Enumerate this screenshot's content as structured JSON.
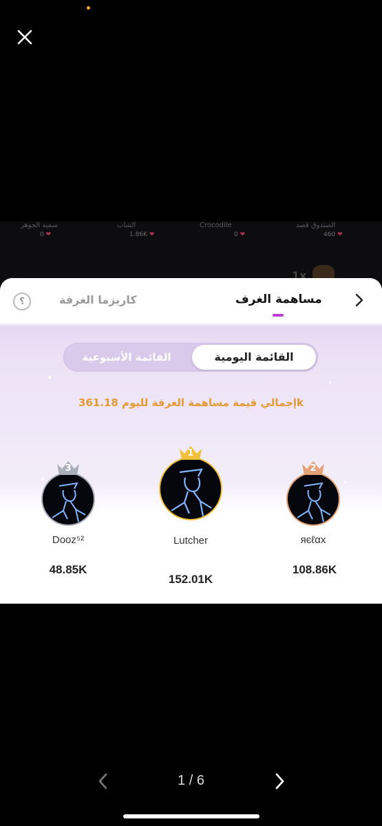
{
  "viewer": {
    "pager_text": "1 / 6"
  },
  "background_strip": [
    {
      "name": "الصندوق قصد",
      "value": "460"
    },
    {
      "name": "Crocodile",
      "value": "0"
    },
    {
      "name": "الشاب",
      "value": "1.86K"
    },
    {
      "name": "سمية الجوهر",
      "value": "0"
    }
  ],
  "background_gift_count": "1x",
  "modal": {
    "tab_contribution": "مساهمة الغرف",
    "tab_charisma": "كاريزما الغرفة",
    "help_icon_char": "؟",
    "toggle_daily": "القائمة اليومية",
    "toggle_weekly": "القائمة الأسبوعية",
    "total_label": "إجمالي قيمة مساهمة الغرفة لليوم 361.18k",
    "accent_color": "#c03ad8",
    "total_color": "#e29a35"
  },
  "podium": [
    {
      "rank": "1",
      "name": "Lutcher",
      "score": "152.01K",
      "crown_color": "#f2c038"
    },
    {
      "rank": "2",
      "name": "яєℓαх",
      "score": "108.86K",
      "crown_color": "#e3a277"
    },
    {
      "rank": "3",
      "name": "Dooz⁵²",
      "score": "48.85K",
      "crown_color": "#a9aeb8"
    }
  ]
}
